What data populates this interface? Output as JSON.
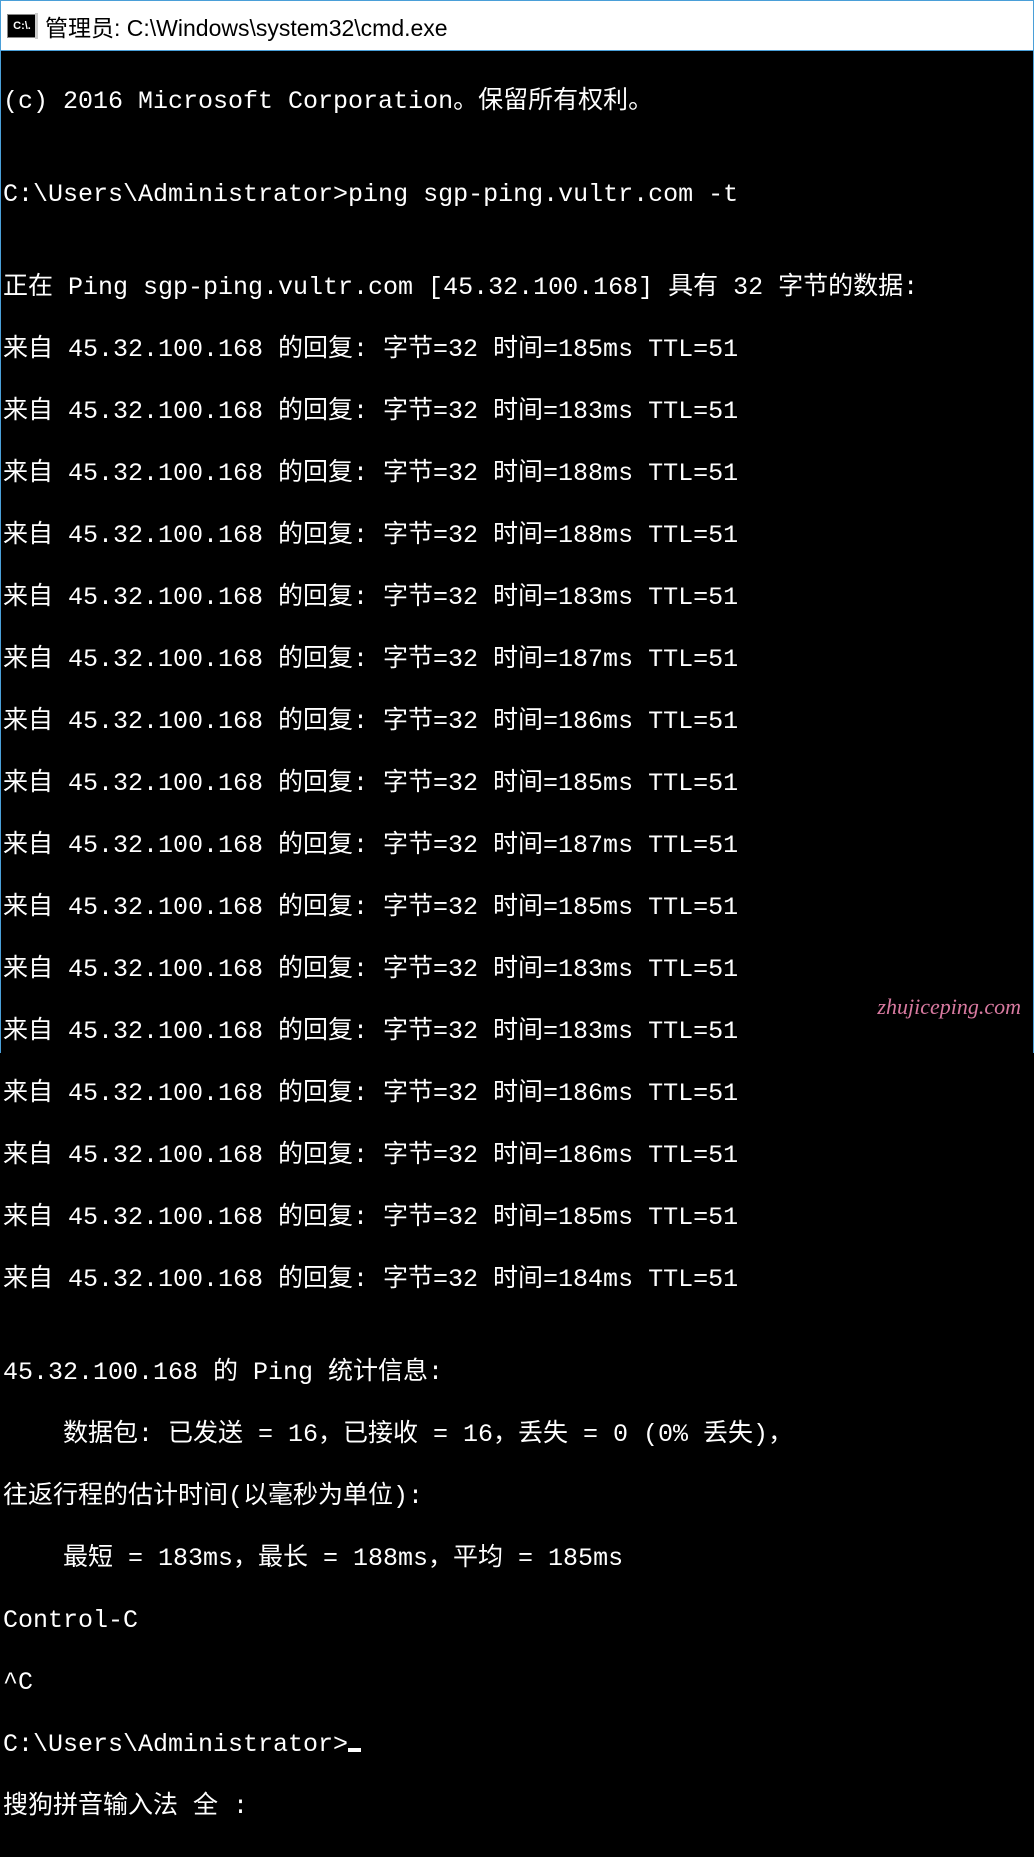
{
  "titlebar": {
    "icon_text": "C:\\.",
    "title": "管理员: C:\\Windows\\system32\\cmd.exe"
  },
  "terminal": {
    "copyright": "(c) 2016 Microsoft Corporation。保留所有权利。",
    "blank1": "",
    "prompt1": "C:\\Users\\Administrator>ping sgp-ping.vultr.com -t",
    "blank2": "",
    "ping_header": "正在 Ping sgp-ping.vultr.com [45.32.100.168] 具有 32 字节的数据:",
    "replies": [
      "来自 45.32.100.168 的回复: 字节=32 时间=185ms TTL=51",
      "来自 45.32.100.168 的回复: 字节=32 时间=183ms TTL=51",
      "来自 45.32.100.168 的回复: 字节=32 时间=188ms TTL=51",
      "来自 45.32.100.168 的回复: 字节=32 时间=188ms TTL=51",
      "来自 45.32.100.168 的回复: 字节=32 时间=183ms TTL=51",
      "来自 45.32.100.168 的回复: 字节=32 时间=187ms TTL=51",
      "来自 45.32.100.168 的回复: 字节=32 时间=186ms TTL=51",
      "来自 45.32.100.168 的回复: 字节=32 时间=185ms TTL=51",
      "来自 45.32.100.168 的回复: 字节=32 时间=187ms TTL=51",
      "来自 45.32.100.168 的回复: 字节=32 时间=185ms TTL=51",
      "来自 45.32.100.168 的回复: 字节=32 时间=183ms TTL=51",
      "来自 45.32.100.168 的回复: 字节=32 时间=183ms TTL=51",
      "来自 45.32.100.168 的回复: 字节=32 时间=186ms TTL=51",
      "来自 45.32.100.168 的回复: 字节=32 时间=186ms TTL=51",
      "来自 45.32.100.168 的回复: 字节=32 时间=185ms TTL=51",
      "来自 45.32.100.168 的回复: 字节=32 时间=184ms TTL=51"
    ],
    "blank3": "",
    "stats_header": "45.32.100.168 的 Ping 统计信息:",
    "stats_packets": "    数据包: 已发送 = 16，已接收 = 16，丢失 = 0 (0% 丢失)，",
    "stats_rtt_header": "往返行程的估计时间(以毫秒为单位):",
    "stats_rtt": "    最短 = 183ms，最长 = 188ms，平均 = 185ms",
    "ctrl_c1": "Control-C",
    "ctrl_c2": "^C",
    "prompt2": "C:\\Users\\Administrator>",
    "ime": "搜狗拼音输入法 全 :"
  },
  "watermark": "zhujiceping.com"
}
